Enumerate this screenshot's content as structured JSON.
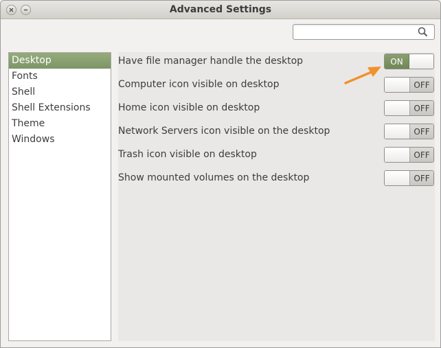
{
  "window": {
    "title": "Advanced Settings"
  },
  "search": {
    "value": "",
    "placeholder": ""
  },
  "sidebar": {
    "items": [
      {
        "label": "Desktop",
        "selected": true
      },
      {
        "label": "Fonts",
        "selected": false
      },
      {
        "label": "Shell",
        "selected": false
      },
      {
        "label": "Shell Extensions",
        "selected": false
      },
      {
        "label": "Theme",
        "selected": false
      },
      {
        "label": "Windows",
        "selected": false
      }
    ]
  },
  "settings": [
    {
      "label": "Have file manager handle the desktop",
      "state": "ON"
    },
    {
      "label": "Computer icon visible on desktop",
      "state": "OFF"
    },
    {
      "label": "Home icon visible on desktop",
      "state": "OFF"
    },
    {
      "label": "Network Servers icon visible on the desktop",
      "state": "OFF"
    },
    {
      "label": "Trash icon visible on desktop",
      "state": "OFF"
    },
    {
      "label": "Show mounted volumes on the desktop",
      "state": "OFF"
    }
  ],
  "colors": {
    "accent_green": "#7d9566",
    "annotation_arrow": "#f0922e"
  },
  "icons": [
    "close-icon",
    "minimize-icon",
    "search-icon",
    "annotation-arrow-icon"
  ]
}
